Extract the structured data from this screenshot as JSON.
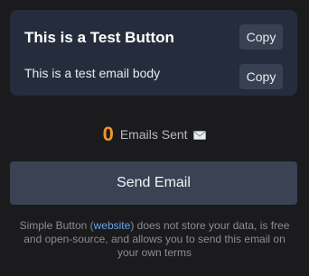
{
  "email": {
    "subject": "This is a Test Button",
    "body": "This is a test email body",
    "copy_label": "Copy"
  },
  "stats": {
    "count": "0",
    "label": "Emails Sent",
    "count_color": "#f0942a"
  },
  "send_button": {
    "label": "Send Email"
  },
  "footer": {
    "prefix": "Simple Button (",
    "link_text": "website",
    "suffix": ") does not store your data, is free and open-source, and allows you to send this email on your own terms",
    "link_color": "#6aa7e8"
  },
  "icons": {
    "mail": "envelope-icon"
  }
}
